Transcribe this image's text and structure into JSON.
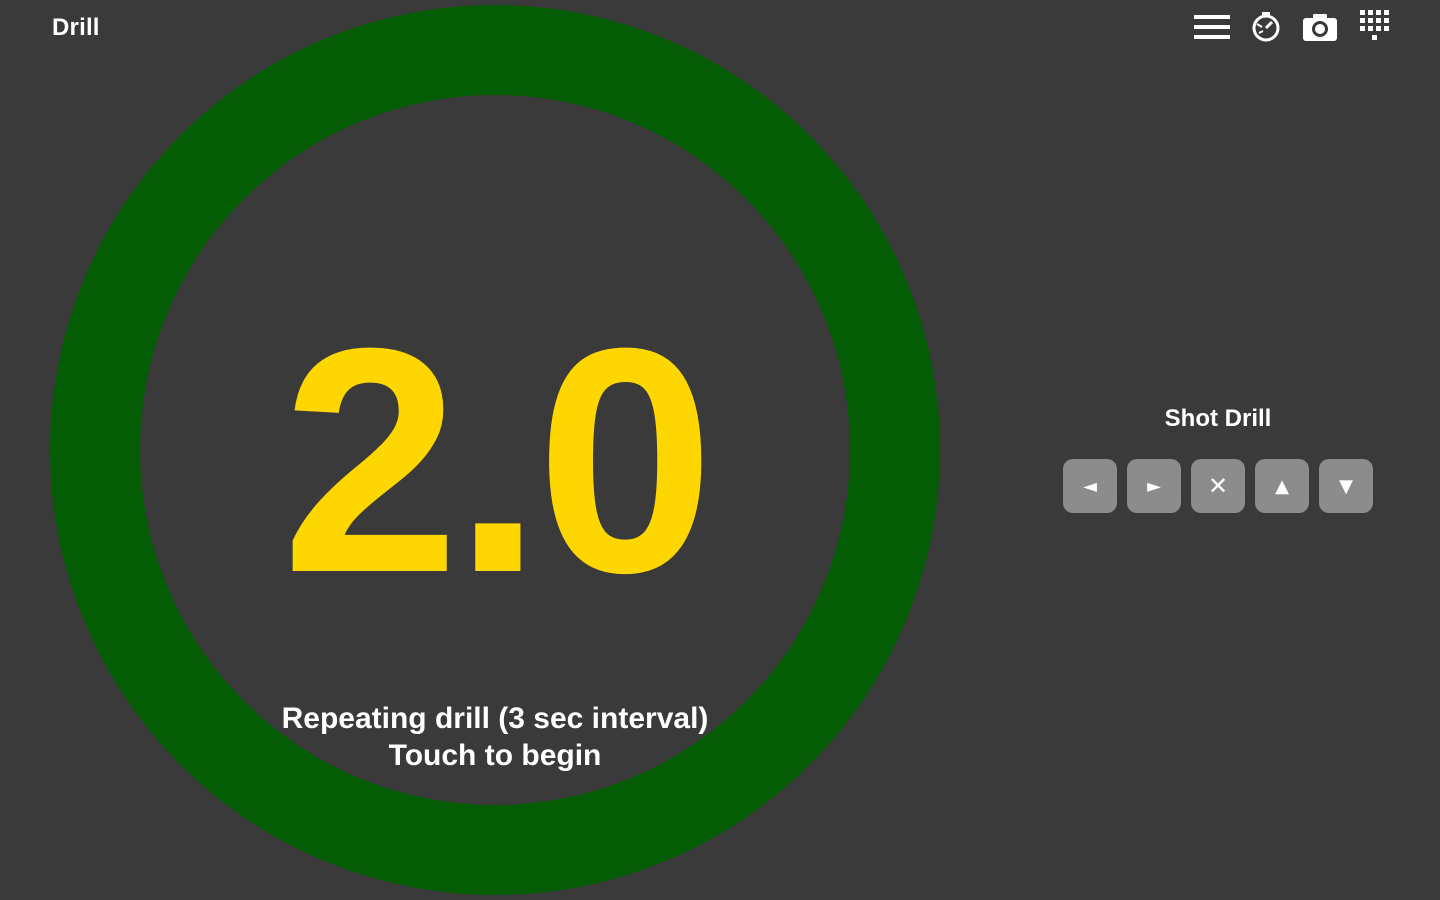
{
  "app": {
    "title": "Drill"
  },
  "toolbar": {
    "icons": [
      "menu-icon",
      "timer-icon",
      "camera-icon",
      "keypad-icon"
    ]
  },
  "timer": {
    "value": "2.0",
    "ring_color": "#045c04",
    "value_color": "#ffd700"
  },
  "status": {
    "line1": "Repeating drill (3 sec interval)",
    "line2": "Touch to begin"
  },
  "side_panel": {
    "title": "Shot Drill",
    "buttons": [
      {
        "name": "previous",
        "glyph": "◄"
      },
      {
        "name": "next",
        "glyph": "►"
      },
      {
        "name": "clear",
        "glyph": "✕"
      },
      {
        "name": "up",
        "glyph": "▲"
      },
      {
        "name": "down",
        "glyph": "▼"
      }
    ],
    "button_color": "#8c8c8c"
  },
  "colors": {
    "background": "#3a3a3a"
  }
}
